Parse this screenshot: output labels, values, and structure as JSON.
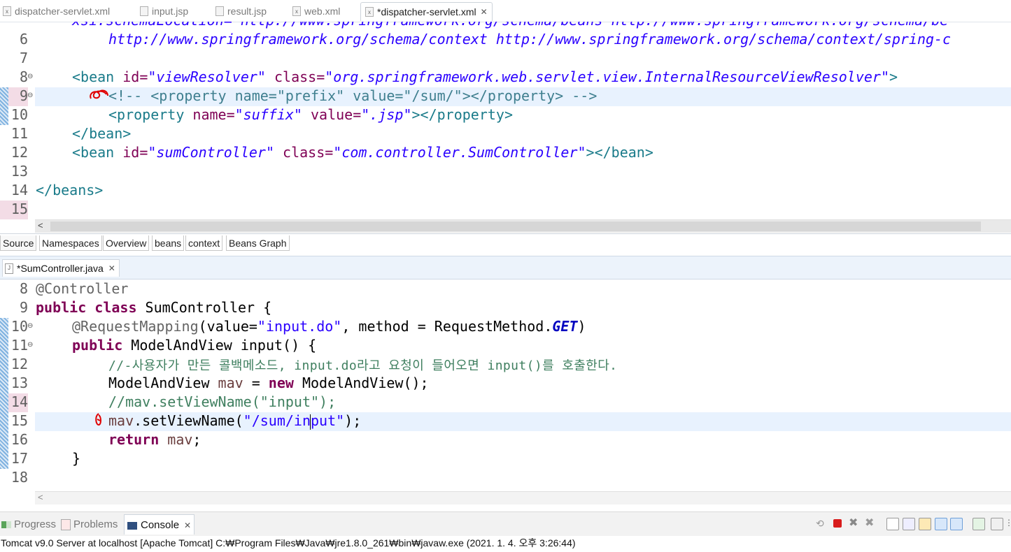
{
  "top_tabs": [
    {
      "label": "dispatcher-servlet.xml"
    },
    {
      "label": "input.jsp"
    },
    {
      "label": "result.jsp"
    },
    {
      "label": "web.xml"
    },
    {
      "label": "*dispatcher-servlet.xml"
    }
  ],
  "xml_editor": {
    "line_numbers": [
      "6",
      "7",
      "8",
      "9",
      "10",
      "11",
      "12",
      "13",
      "14",
      "15"
    ],
    "lines": {
      "l6": "http://www.springframework.org/schema/context http://www.springframework.org/schema/context/spring-c",
      "l8_open": "<bean ",
      "l8_id_attr": "id=",
      "l8_id_val": "\"viewResolver\"",
      "l8_class_attr": " class=",
      "l8_class_val": "\"org.springframework.web.servlet.view.InternalResourceViewResolver\"",
      "l8_close": ">",
      "l9": "<!-- <property name=\"prefix\" value=\"/sum/\"></property> -->",
      "l10_open": "<property ",
      "l10_name_attr": "name=",
      "l10_name_val": "\"suffix\"",
      "l10_value_attr": " value=",
      "l10_value_val": "\".jsp\"",
      "l10_close": "></property>",
      "l11": "</bean>",
      "l12_open": "<bean ",
      "l12_id_attr": "id=",
      "l12_id_val": "\"sumController\"",
      "l12_class_attr": " class=",
      "l12_class_val": "\"com.controller.SumController\"",
      "l12_close": "></bean>",
      "l14": "</beans>"
    }
  },
  "sub_tabs": [
    {
      "label": "Source"
    },
    {
      "label": "Namespaces"
    },
    {
      "label": "Overview"
    },
    {
      "label": "beans"
    },
    {
      "label": "context"
    },
    {
      "label": "Beans Graph"
    }
  ],
  "java_tab": {
    "label": "*SumController.java"
  },
  "java_editor": {
    "line_numbers": [
      "8",
      "9",
      "10",
      "11",
      "12",
      "13",
      "14",
      "15",
      "16",
      "17",
      "18"
    ],
    "lines": {
      "l8": "@Controller",
      "l9_kw": "public class",
      "l9_rest": " SumController {",
      "l10_ann": "@RequestMapping",
      "l10_a": "(value=",
      "l10_str": "\"input.do\"",
      "l10_b": ", method = RequestMethod.",
      "l10_get": "GET",
      "l10_c": ")",
      "l11_kw": "public",
      "l11_rest": " ModelAndView input() {",
      "l12": "//-사용자가 만든 콜백메소드, input.do라고 요청이 들어오면 input()를 호출한다.",
      "l13_a": "ModelAndView ",
      "l13_var": "mav",
      "l13_b": " = ",
      "l13_kw": "new",
      "l13_c": " ModelAndView();",
      "l14": "//mav.setViewName(\"input\");",
      "l15_var": "mav",
      "l15_a": ".setViewName(",
      "l15_str": "\"/sum/input\"",
      "l15_b": ");",
      "l16_kw": "return",
      "l16_var": " mav",
      "l16_b": ";",
      "l17": "}"
    }
  },
  "bottom_tabs": [
    {
      "label": "Progress"
    },
    {
      "label": "Problems"
    },
    {
      "label": "Console"
    }
  ],
  "status_line": "Tomcat v9.0 Server at localhost [Apache Tomcat] C:₩Program Files₩Java₩jre1.8.0_261₩bin₩javaw.exe  (2021. 1. 4. 오후 3:26:44)",
  "colors": {
    "accent": "#e8f2fe",
    "xml_tag": "#1a7b8a",
    "keyword": "#7f0055",
    "string": "#2a00ff"
  }
}
